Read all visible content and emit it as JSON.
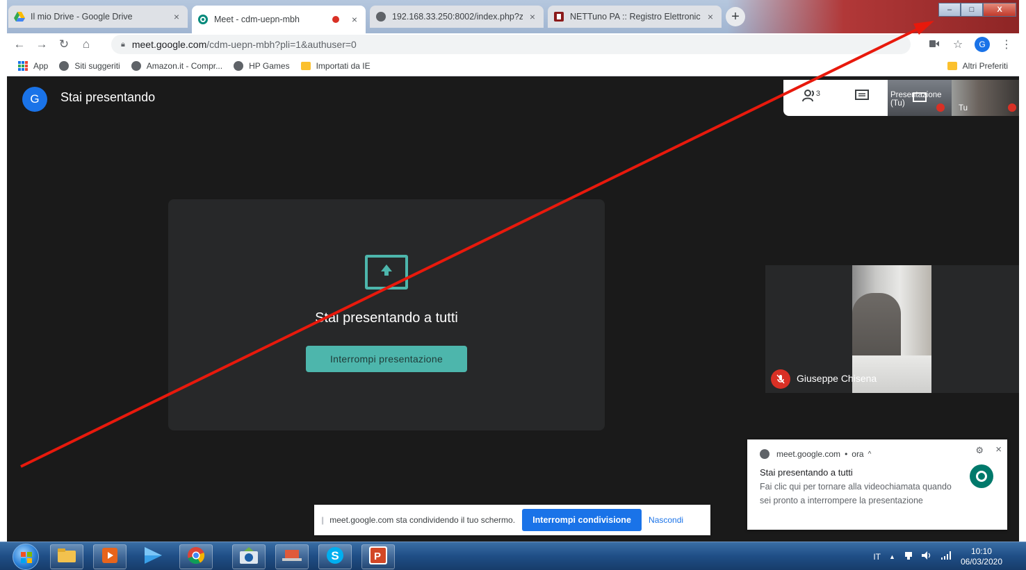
{
  "browser": {
    "tabs": [
      {
        "title": "Il mio Drive - Google Drive",
        "icon": "google-drive-icon",
        "active": false
      },
      {
        "title": "Meet - cdm-uepn-mbh",
        "icon": "google-meet-icon",
        "active": true,
        "recording": true
      },
      {
        "title": "192.168.33.250:8002/index.php?z",
        "icon": "globe-icon",
        "active": false
      },
      {
        "title": "NETTuno PA :: Registro Elettronic",
        "icon": "nettuno-icon",
        "active": false
      }
    ],
    "new_tab": "+",
    "close_glyph": "×",
    "window_buttons": {
      "minimize": "–",
      "maximize": "□",
      "close": "X"
    },
    "address": {
      "host": "meet.google.com",
      "path": "/cdm-uepn-mbh?pli=1&authuser=0"
    },
    "profile_initial": "G",
    "bookmarks": [
      {
        "label": "App",
        "icon": "apps-grid-icon"
      },
      {
        "label": "Siti suggeriti",
        "icon": "globe-icon"
      },
      {
        "label": "Amazon.it - Compr...",
        "icon": "globe-icon"
      },
      {
        "label": "HP Games",
        "icon": "globe-icon"
      },
      {
        "label": "Importati da IE",
        "icon": "folder-icon"
      }
    ],
    "other_bookmarks": "Altri Preferiti"
  },
  "meet": {
    "avatar_initial": "G",
    "header_title": "Stai presentando",
    "participants_count": "3",
    "self_presentation_label": "Presentazione (Tu)",
    "self_presentation_line1": "Presentazione",
    "self_presentation_line2": "(Tu)",
    "self_video_label": "Tu",
    "present_message": "Stai presentando a tutti",
    "stop_presenting_button": "Interrompi presentazione",
    "participant_name": "Giuseppe Chisena"
  },
  "share_bar": {
    "grip": "||",
    "message": "meet.google.com sta condividendo il tuo schermo.",
    "stop_button": "Interrompi condivisione",
    "hide_button": "Nascondi"
  },
  "notification": {
    "source": "meet.google.com",
    "separator": "•",
    "time": "ora",
    "caret": "^",
    "title": "Stai presentando a tutti",
    "body": "Fai clic qui per tornare alla videochiamata quando sei pronto a interrompere la presentazione"
  },
  "taskbar": {
    "language": "IT",
    "time": "10:10",
    "date": "06/03/2020"
  },
  "colors": {
    "meet_bg": "#1a1a1a",
    "accent_teal": "#4db6ac",
    "google_blue": "#1a73e8",
    "mute_red": "#d93025",
    "annotation_red": "#e8190c"
  }
}
